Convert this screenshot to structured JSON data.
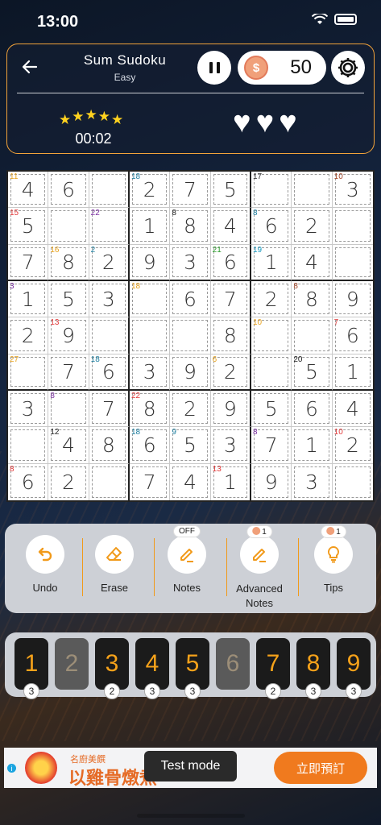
{
  "status_bar": {
    "time": "13:00"
  },
  "header": {
    "title": "Sum Sudoku",
    "difficulty": "Easy",
    "coins": "50",
    "stars": [
      "★",
      "★",
      "★",
      "★",
      "★"
    ],
    "timer": "00:02",
    "lives": [
      "♥",
      "♥",
      "♥"
    ]
  },
  "board": {
    "rows": [
      [
        "4",
        "6",
        "",
        "2",
        "7",
        "5",
        "",
        "",
        "3"
      ],
      [
        "5",
        "",
        "",
        "1",
        "8",
        "4",
        "6",
        "2",
        ""
      ],
      [
        "7",
        "8",
        "2",
        "9",
        "3",
        "6",
        "1",
        "4",
        ""
      ],
      [
        "1",
        "5",
        "3",
        "",
        "6",
        "7",
        "2",
        "8",
        "9"
      ],
      [
        "2",
        "9",
        "",
        "",
        "",
        "8",
        "",
        "",
        "6"
      ],
      [
        "",
        "7",
        "6",
        "3",
        "9",
        "2",
        "",
        "5",
        "1"
      ],
      [
        "3",
        "",
        "7",
        "8",
        "2",
        "9",
        "5",
        "6",
        "4"
      ],
      [
        "",
        "4",
        "8",
        "6",
        "5",
        "3",
        "7",
        "1",
        "2"
      ],
      [
        "6",
        "2",
        "",
        "7",
        "4",
        "1",
        "9",
        "3",
        ""
      ]
    ],
    "cage_sums": [
      {
        "row": 0,
        "col": 0,
        "sum": "11",
        "color": "#e8a21c"
      },
      {
        "row": 0,
        "col": 3,
        "sum": "18",
        "color": "#1f7fa0"
      },
      {
        "row": 0,
        "col": 6,
        "sum": "17",
        "color": "#333333"
      },
      {
        "row": 0,
        "col": 8,
        "sum": "10",
        "color": "#a5482a"
      },
      {
        "row": 1,
        "col": 0,
        "sum": "15",
        "color": "#e23a3a"
      },
      {
        "row": 1,
        "col": 2,
        "sum": "22",
        "color": "#7a2fa0"
      },
      {
        "row": 1,
        "col": 4,
        "sum": "8",
        "color": "#222222"
      },
      {
        "row": 1,
        "col": 6,
        "sum": "8",
        "color": "#1f7fa0"
      },
      {
        "row": 2,
        "col": 1,
        "sum": "16",
        "color": "#e8a21c"
      },
      {
        "row": 2,
        "col": 2,
        "sum": "2",
        "color": "#1f7fa0"
      },
      {
        "row": 2,
        "col": 5,
        "sum": "21",
        "color": "#2a9a2a"
      },
      {
        "row": 2,
        "col": 6,
        "sum": "19",
        "color": "#1a9ac0"
      },
      {
        "row": 3,
        "col": 0,
        "sum": "3",
        "color": "#7a2fa0"
      },
      {
        "row": 3,
        "col": 3,
        "sum": "18",
        "color": "#e8a21c"
      },
      {
        "row": 3,
        "col": 7,
        "sum": "8",
        "color": "#a5482a"
      },
      {
        "row": 4,
        "col": 1,
        "sum": "13",
        "color": "#e23a3a"
      },
      {
        "row": 4,
        "col": 6,
        "sum": "10",
        "color": "#e8a21c"
      },
      {
        "row": 4,
        "col": 8,
        "sum": "7",
        "color": "#e23a3a"
      },
      {
        "row": 5,
        "col": 0,
        "sum": "27",
        "color": "#e8a21c"
      },
      {
        "row": 5,
        "col": 2,
        "sum": "18",
        "color": "#1f7fa0"
      },
      {
        "row": 5,
        "col": 5,
        "sum": "6",
        "color": "#e8a21c"
      },
      {
        "row": 5,
        "col": 7,
        "sum": "20",
        "color": "#222222"
      },
      {
        "row": 6,
        "col": 1,
        "sum": "8",
        "color": "#7a2fa0"
      },
      {
        "row": 6,
        "col": 3,
        "sum": "22",
        "color": "#e23a3a"
      },
      {
        "row": 7,
        "col": 1,
        "sum": "12",
        "color": "#222222"
      },
      {
        "row": 7,
        "col": 3,
        "sum": "18",
        "color": "#1f7fa0"
      },
      {
        "row": 7,
        "col": 4,
        "sum": "9",
        "color": "#1f7fa0"
      },
      {
        "row": 7,
        "col": 6,
        "sum": "8",
        "color": "#7a2fa0"
      },
      {
        "row": 7,
        "col": 8,
        "sum": "10",
        "color": "#e23a3a"
      },
      {
        "row": 8,
        "col": 0,
        "sum": "8",
        "color": "#e23a3a"
      },
      {
        "row": 8,
        "col": 5,
        "sum": "13",
        "color": "#e23a3a"
      }
    ]
  },
  "tools": {
    "undo": "Undo",
    "erase": "Erase",
    "notes": "Notes",
    "notes_state": "OFF",
    "advanced_notes": "Advanced\nNotes",
    "advanced_notes_cost": "1",
    "tips": "Tips",
    "tips_cost": "1"
  },
  "numpad": [
    {
      "digit": "1",
      "count": "3",
      "used": false
    },
    {
      "digit": "2",
      "count": "",
      "used": true
    },
    {
      "digit": "3",
      "count": "2",
      "used": false
    },
    {
      "digit": "4",
      "count": "3",
      "used": false
    },
    {
      "digit": "5",
      "count": "3",
      "used": false
    },
    {
      "digit": "6",
      "count": "",
      "used": true
    },
    {
      "digit": "7",
      "count": "2",
      "used": false
    },
    {
      "digit": "8",
      "count": "3",
      "used": false
    },
    {
      "digit": "9",
      "count": "3",
      "used": false
    }
  ],
  "ad": {
    "brand": "名廚美饌",
    "headline": "以雞骨燉煮",
    "cta": "立即預訂"
  },
  "test_mode": "Test mode",
  "colors": {
    "accent": "#f19a1a",
    "panel_border": "#f2a33a"
  }
}
